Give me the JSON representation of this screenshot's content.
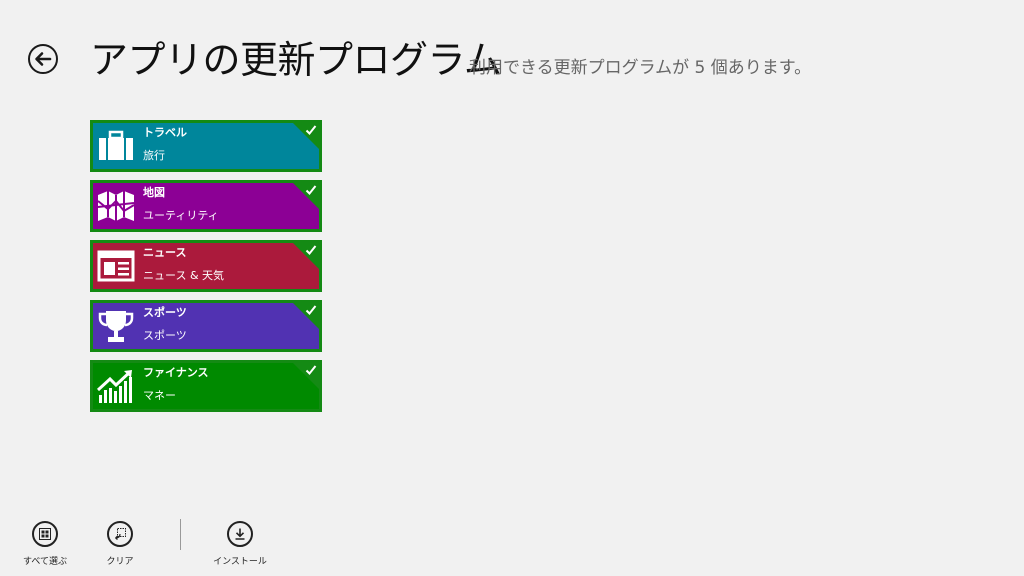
{
  "header": {
    "title": "アプリの更新プログラム",
    "subtitle": "利用できる更新プログラムが 5 個あります。"
  },
  "updates": [
    {
      "name": "トラベル",
      "category": "旅行",
      "color": "#00869b",
      "icon": "suitcase-icon",
      "selected": true
    },
    {
      "name": "地図",
      "category": "ユーティリティ",
      "color": "#8c0095",
      "icon": "map-icon",
      "selected": true
    },
    {
      "name": "ニュース",
      "category": "ニュース & 天気",
      "color": "#ab1a3c",
      "icon": "newspaper-icon",
      "selected": true
    },
    {
      "name": "スポーツ",
      "category": "スポーツ",
      "color": "#5132b2",
      "icon": "trophy-icon",
      "selected": true
    },
    {
      "name": "ファイナンス",
      "category": "マネー",
      "color": "#008a00",
      "icon": "finance-chart-icon",
      "selected": true
    }
  ],
  "appbar": {
    "select_all": "すべて選ぶ",
    "clear": "クリア",
    "install": "インストール"
  },
  "colors": {
    "selection_border": "#148a14",
    "background": "#f1f1f1"
  }
}
